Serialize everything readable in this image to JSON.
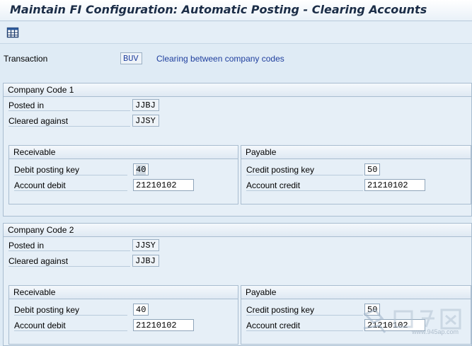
{
  "window": {
    "title": "Maintain FI Configuration: Automatic Posting - Clearing Accounts"
  },
  "toolbar": {
    "buttons": [
      {
        "icon": "table-view-icon"
      }
    ]
  },
  "transaction": {
    "label": "Transaction",
    "value": "BUV",
    "description": "Clearing between company codes"
  },
  "company_code_1": {
    "title": "Company Code 1",
    "posted_in_label": "Posted in",
    "posted_in_value": "JJBJ",
    "cleared_against_label": "Cleared against",
    "cleared_against_value": "JJSY",
    "receivable": {
      "title": "Receivable",
      "debit_posting_key_label": "Debit posting key",
      "debit_posting_key_value": "40",
      "account_debit_label": "Account debit",
      "account_debit_value": "21210102"
    },
    "payable": {
      "title": "Payable",
      "credit_posting_key_label": "Credit posting key",
      "credit_posting_key_value": "50",
      "account_credit_label": "Account credit",
      "account_credit_value": "21210102"
    }
  },
  "company_code_2": {
    "title": "Company Code 2",
    "posted_in_label": "Posted in",
    "posted_in_value": "JJSY",
    "cleared_against_label": "Cleared against",
    "cleared_against_value": "JJBJ",
    "receivable": {
      "title": "Receivable",
      "debit_posting_key_label": "Debit posting key",
      "debit_posting_key_value": "40",
      "account_debit_label": "Account debit",
      "account_debit_value": "21210102"
    },
    "payable": {
      "title": "Payable",
      "credit_posting_key_label": "Credit posting key",
      "credit_posting_key_value": "50",
      "account_credit_label": "Account credit",
      "account_credit_value": "21210102"
    }
  },
  "watermark": {
    "text": "www.945ap.com"
  }
}
